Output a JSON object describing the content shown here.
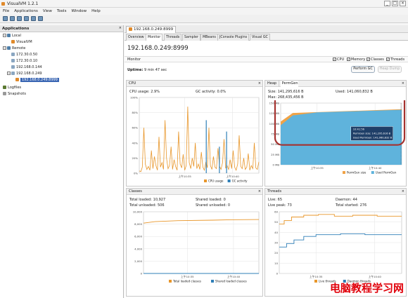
{
  "window": {
    "title": "VisualVM 1.2.1",
    "min": "_",
    "max": "□",
    "close": "×"
  },
  "menu": [
    "File",
    "Applications",
    "View",
    "Tools",
    "Window",
    "Help"
  ],
  "applications": {
    "header": "Applications",
    "close": "×",
    "tree": {
      "local": "Local",
      "visualvm": "VisualVM",
      "remote": "Remote",
      "hosts": [
        "172.30.0.50",
        "172.30.0.10",
        "192.168.0.144",
        "192.168.0.249"
      ],
      "selected_app": "192.168.0.249:8999",
      "logfiles": "Logfiles",
      "snapshots": "Snapshots"
    }
  },
  "doc_tab": "192.168.0.249:8999",
  "subtabs": [
    "Overview",
    "Monitor",
    "Threads",
    "Sampler",
    "MBeans",
    "JConsole Plugins",
    "Visual GC"
  ],
  "app_title": "192.168.0.249:8999",
  "monitor": {
    "label": "Monitor",
    "checkboxes": [
      "CPU",
      "Memory",
      "Classes",
      "Threads"
    ],
    "uptime_label": "Uptime:",
    "uptime_value": "9 min 47 sec",
    "perform_gc": "Perform GC",
    "heap_dump": "Heap Dump"
  },
  "cpu": {
    "title": "CPU",
    "usage_label": "CPU usage:",
    "usage_value": "2.9%",
    "gc_label": "GC activity:",
    "gc_value": "0.0%",
    "legend": [
      "CPU usage",
      "GC activity"
    ],
    "x_ticks": [
      "上午10:35",
      "上午10:40"
    ],
    "y_ticks": [
      "100%",
      "80%",
      "60%",
      "40%",
      "20%",
      "0%"
    ],
    "colors": {
      "cpu": "#e8962a",
      "gc": "#2f7fb7"
    }
  },
  "heap": {
    "tabs": [
      "Heap",
      "PermGen"
    ],
    "size_label": "Size:",
    "size_value": "141,295,616 B",
    "used_label": "Used:",
    "used_value": "141,060,832 B",
    "max_label": "Max:",
    "max_value": "268,435,456 B",
    "tooltip_time": "10:41:56",
    "tooltip_size": "PermGen size: 141,295,616 B",
    "tooltip_used": "Used PermGen: 141,060,832 B",
    "legend": [
      "PermGen size",
      "Used PermGen"
    ],
    "y_ticks": [
      "150 MB",
      "125 MB",
      "100 MB",
      "75 MB",
      "50 MB",
      "25 MB",
      "0 MB"
    ],
    "x_ticks": [
      "上午10:35",
      "上午10:40"
    ],
    "colors": {
      "size": "#f0a347",
      "used": "#5fb3dc",
      "highlight": "#a5322f"
    }
  },
  "classes": {
    "title": "Classes",
    "total_loaded_label": "Total loaded:",
    "total_loaded": "10,927",
    "shared_loaded_label": "Shared loaded:",
    "shared_loaded": "0",
    "total_unloaded_label": "Total unloaded:",
    "total_unloaded": "506",
    "shared_unloaded_label": "Shared unloaded:",
    "shared_unloaded": "0",
    "y_ticks": [
      "10,000",
      "8,000",
      "6,000",
      "4,000",
      "2,000",
      "0"
    ],
    "x_ticks": [
      "上午10:35",
      "上午10:40"
    ],
    "legend": [
      "Total loaded classes",
      "Shared loaded classes"
    ],
    "colors": {
      "total": "#e8962a",
      "shared": "#2f7fb7"
    }
  },
  "threads": {
    "title": "Threads",
    "live_label": "Live:",
    "live": "65",
    "daemon_label": "Daemon:",
    "daemon": "44",
    "peak_label": "Live peak:",
    "peak": "73",
    "started_label": "Total started:",
    "started": "276",
    "y_ticks": [
      "60",
      "50",
      "40",
      "30",
      "20",
      "10",
      "0"
    ],
    "x_ticks": [
      "上午10:35",
      "上午10:40"
    ],
    "legend": [
      "Live threads",
      "Daemon threads"
    ],
    "colors": {
      "live": "#e8962a",
      "daemon": "#2f7fb7"
    }
  },
  "watermark": "电脑教程学习网"
}
